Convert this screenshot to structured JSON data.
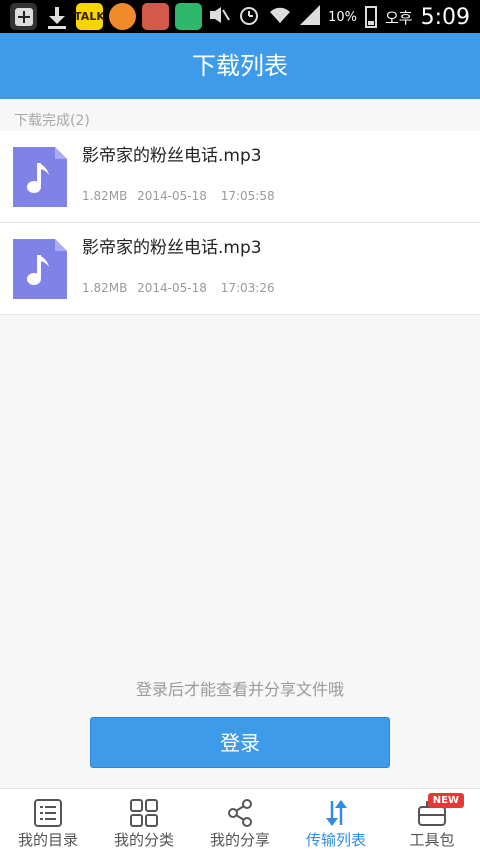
{
  "status_bar": {
    "battery": "10%",
    "korean": "오후",
    "time": "5:09",
    "app_icons": [
      {
        "name": "add-icon",
        "color": "#ffffff"
      },
      {
        "name": "download-icon",
        "color": "#ffffff"
      },
      {
        "name": "kakaotalk-icon",
        "label": "TALK",
        "color": "#f7d600"
      },
      {
        "name": "orange-app-icon",
        "color": "#f08a2b"
      },
      {
        "name": "avatar-app-icon",
        "color": "#d35a4a"
      },
      {
        "name": "game-app-icon",
        "color": "#2fb86c"
      }
    ]
  },
  "title": "下载列表",
  "section_header": "下载完成(2)",
  "files": [
    {
      "name": "影帝家的粉丝电话.mp3",
      "size": "1.82MB",
      "date": "2014-05-18",
      "time": "17:05:58"
    },
    {
      "name": "影帝家的粉丝电话.mp3",
      "size": "1.82MB",
      "date": "2014-05-18",
      "time": "17:03:26"
    }
  ],
  "login_prompt": "登录后才能查看并分享文件哦",
  "login_button": "登录",
  "tabs": [
    {
      "label": "我的目录",
      "icon": "list-icon",
      "active": false
    },
    {
      "label": "我的分类",
      "icon": "grid-icon",
      "active": false
    },
    {
      "label": "我的分享",
      "icon": "share-icon",
      "active": false
    },
    {
      "label": "传输列表",
      "icon": "transfer-icon",
      "active": true
    },
    {
      "label": "工具包",
      "icon": "toolbox-icon",
      "active": false,
      "badge": "NEW"
    }
  ],
  "colors": {
    "accent": "#3d9be9",
    "file_icon": "#7f83e8",
    "badge": "#e53935"
  }
}
